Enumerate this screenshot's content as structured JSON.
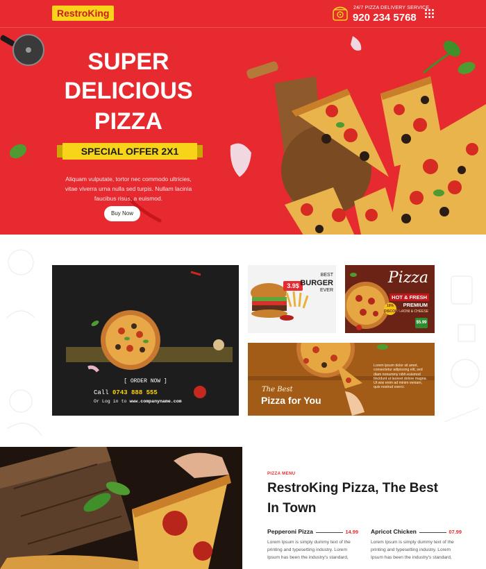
{
  "header": {
    "logo": "RestroKing",
    "service_label": "24/7 PIZZA DELIVERY SERVICE",
    "phone": "920 234 5768",
    "menu_icon": "grid-dots-icon",
    "phone_icon": "telephone-icon"
  },
  "hero": {
    "title_line1": "SUPER",
    "title_line2": "DELICIOUS",
    "title_line3": "PIZZA",
    "offer": "SPECIAL OFFER 2X1",
    "description": "Aliquam vulputate, tortor nec commodo ultricies, vitae viverra urna nulla sed turpis. Nullam lacinia faucibus risus, a euismod.",
    "button": "Buy Now"
  },
  "gallery": {
    "main": {
      "order": "[ ORDER NOW ]",
      "call": "Call",
      "number": "0743 888 555",
      "login": "Or Log in to",
      "url": "www.companyname.com"
    },
    "burger": {
      "price": "3.9$",
      "line1": "BEST",
      "line2": "BURGER",
      "line3": "EVER"
    },
    "hot": {
      "title": "Pizza",
      "badge": "HOT & FRESH",
      "premium": "PREMIUM",
      "sub": "PEPPERONI & CHEESE",
      "discount": "10% DISCOUNT",
      "price": "$5.99"
    },
    "best": {
      "script": "The Best",
      "title": "Pizza for You",
      "body": "Lorem ipsum dolor sit amet, consectetur adipiscing elit, sed diam nonummy nibh euismod tincidunt ut laoreet dolore magna. Ut wisi enim ad minim veniam, quis nostrud exerci."
    }
  },
  "menu": {
    "kicker": "PIZZA MENU",
    "heading_line1": "RestroKing Pizza, The Best",
    "heading_line2": "In Town",
    "items": [
      {
        "name": "Pepperoni Pizza",
        "price": "14.99",
        "desc": "Lorem Ipsum is simply dummy text of the printing and typesetting industry. Lorem Ipsum has been the industry's standard,"
      },
      {
        "name": "Apricot Chicken",
        "price": "07.99",
        "desc": "Lorem Ipsum is simply dummy text of the printing and typesetting industry. Lorem Ipsum has been the industry's standard,"
      }
    ]
  },
  "colors": {
    "brand_red": "#e62a2f",
    "logo_yellow": "#f7d31a",
    "offer_yellow": "#f7d31a"
  }
}
